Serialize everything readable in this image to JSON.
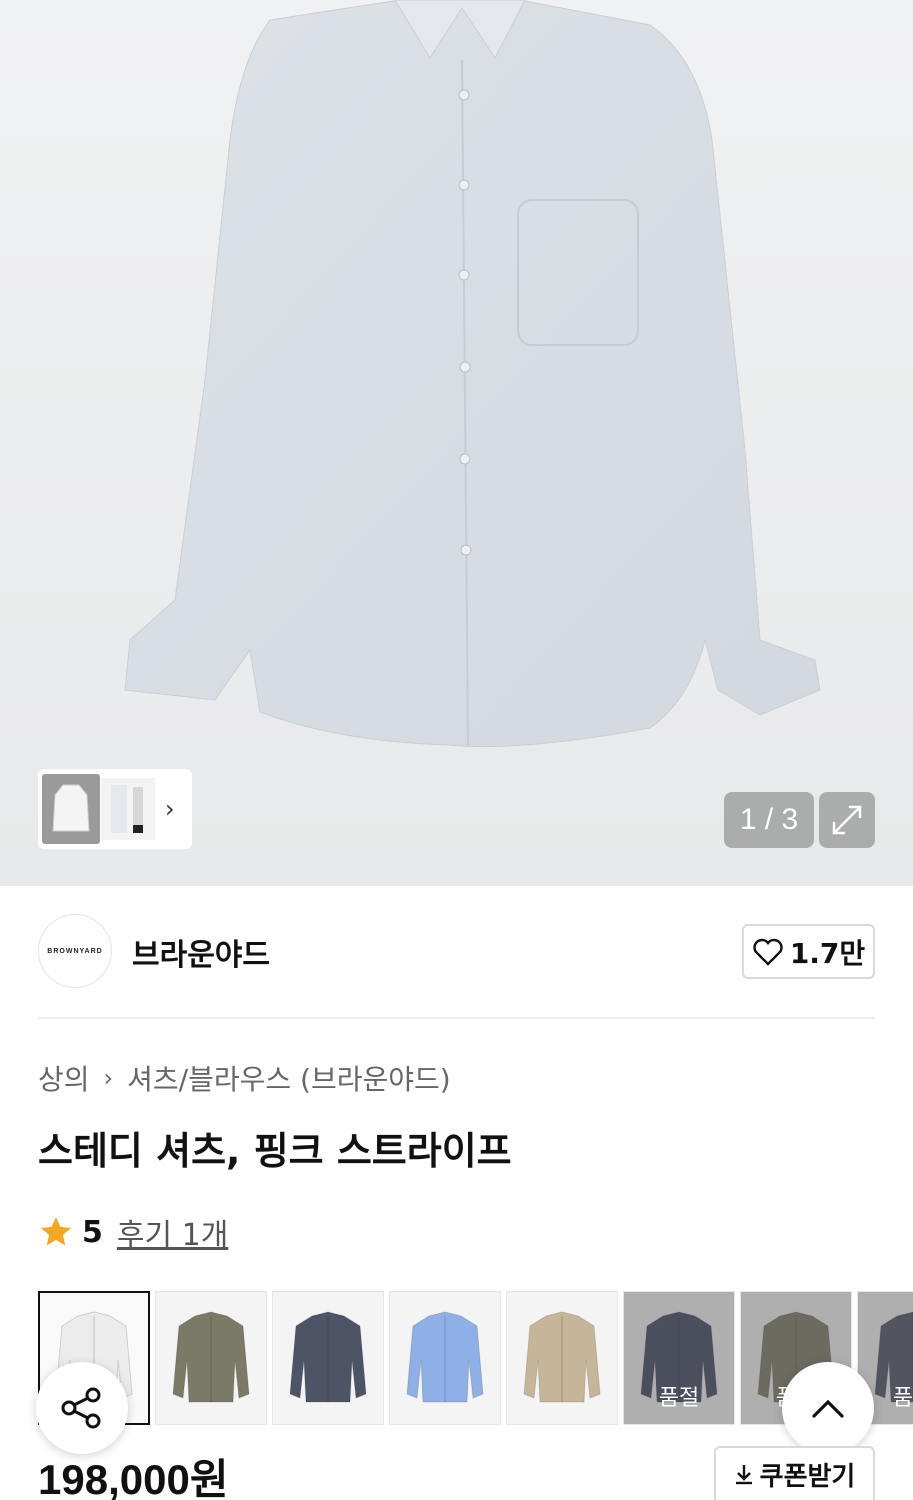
{
  "gallery": {
    "counter": "1 / 3",
    "expand_icon": "expand-icon",
    "thumb_next_icon": "chevron-right-icon"
  },
  "brand": {
    "logo_text": "BROWNYARD",
    "name": "브라운야드",
    "like_count": "1.7만"
  },
  "breadcrumb": {
    "level1": "상의",
    "level2": "셔츠/블라우스 (브라운야드)"
  },
  "product": {
    "title": "스테디 셔츠, 핑크 스트라이프",
    "rating_score": "5",
    "review_link": "후기 1개",
    "price": "198,000원",
    "coupon_label": "쿠폰받기"
  },
  "swatches": [
    {
      "color": "#ececec",
      "selected": true,
      "label": ""
    },
    {
      "color": "#7b7a66",
      "selected": false,
      "label": ""
    },
    {
      "color": "#4d5466",
      "selected": false,
      "label": ""
    },
    {
      "color": "#8fb0e6",
      "selected": false,
      "label": ""
    },
    {
      "color": "#c7b59a",
      "selected": false,
      "label": ""
    },
    {
      "color": "#3f4660",
      "selected": false,
      "label": "품절"
    },
    {
      "color": "#7a7864",
      "selected": false,
      "label": "품절"
    },
    {
      "color": "#4b5164",
      "selected": false,
      "label": "품절"
    }
  ],
  "colors": {
    "star": "#f5a623",
    "text": "#111111",
    "muted": "#666666"
  }
}
